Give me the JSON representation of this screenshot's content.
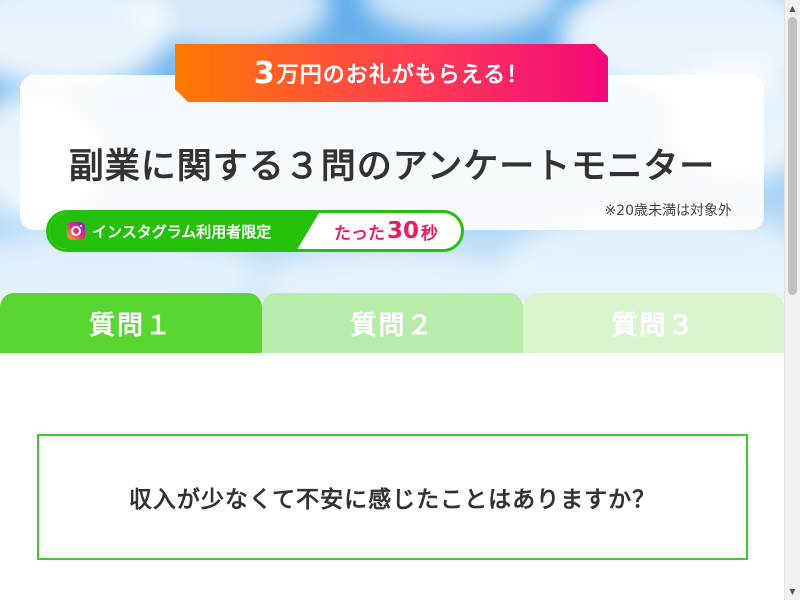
{
  "hero": {
    "reward_number": "3",
    "reward_text": "万円のお礼がもらえる！",
    "title": "副業に関する３問のアンケートモニター",
    "note": "※20歳未満は対象外",
    "badge": {
      "label": "インスタグラム利用者限定",
      "time_prefix": "たった",
      "time_number": "30",
      "time_suffix": "秒",
      "icon": "instagram-icon"
    }
  },
  "tabs": [
    {
      "label": "質問１",
      "active": true
    },
    {
      "label": "質問２",
      "active": false
    },
    {
      "label": "質問３",
      "active": false
    }
  ],
  "question": {
    "text": "収入が少なくて不安に感じたことはありますか？"
  },
  "colors": {
    "accent_green": "#24c00c",
    "tab_active": "#5ad633",
    "banner_start": "#ff7a00",
    "banner_end": "#f4087a",
    "highlight_pink": "#ee1c5a"
  }
}
